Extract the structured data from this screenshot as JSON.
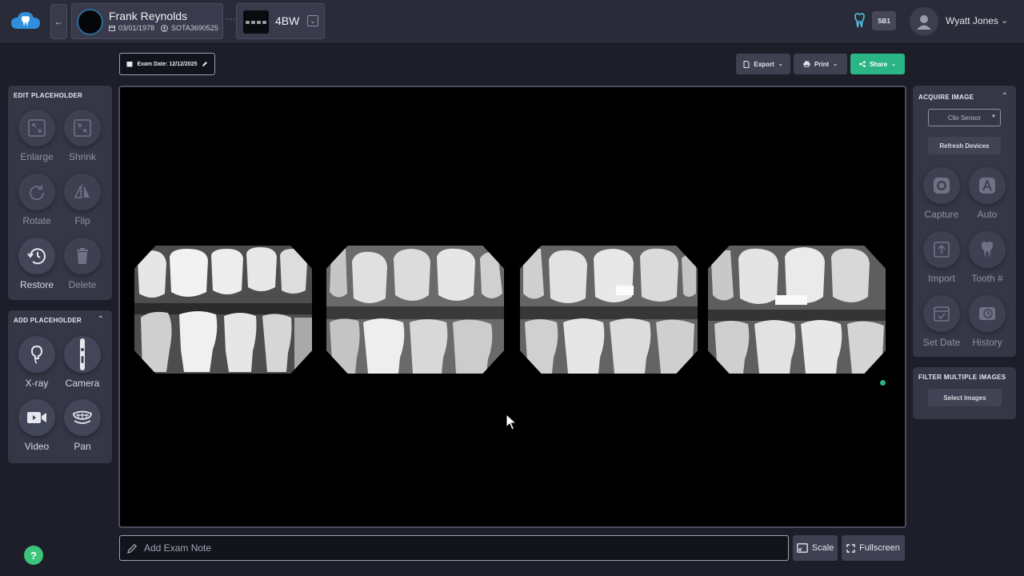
{
  "header": {
    "patient": {
      "name": "Frank Reynolds",
      "dob": "03/01/1978",
      "patient_id": "SOTA3690525"
    },
    "exam_type": "4BW",
    "badge": "SB1",
    "user_name": "Wyatt Jones"
  },
  "toolbar": {
    "exam_date": "Exam Date: 12/12/2025",
    "export_label": "Export",
    "print_label": "Print",
    "share_label": "Share"
  },
  "edit_panel": {
    "title": "EDIT PLACEHOLDER",
    "tools": [
      "Enlarge",
      "Shrink",
      "Rotate",
      "Flip",
      "Restore",
      "Delete"
    ]
  },
  "add_panel": {
    "title": "ADD PLACEHOLDER",
    "tools": [
      "X-ray",
      "Camera",
      "Video",
      "Pan"
    ]
  },
  "acquire_panel": {
    "title": "ACQUIRE IMAGE",
    "sensor_value": "Clio Sensor",
    "refresh_label": "Refresh Devices",
    "tools": [
      "Capture",
      "Auto",
      "Import",
      "Tooth #",
      "Set Date",
      "History"
    ]
  },
  "filter_panel": {
    "title": "FILTER MULTIPLE IMAGES",
    "select_label": "Select Images"
  },
  "footer": {
    "note_placeholder": "Add Exam Note",
    "scale_label": "Scale",
    "fullscreen_label": "Fullscreen",
    "help_label": "?"
  },
  "colors": {
    "accent_green": "#2bb585",
    "background": "#1d1e2a",
    "panel": "#353747"
  }
}
